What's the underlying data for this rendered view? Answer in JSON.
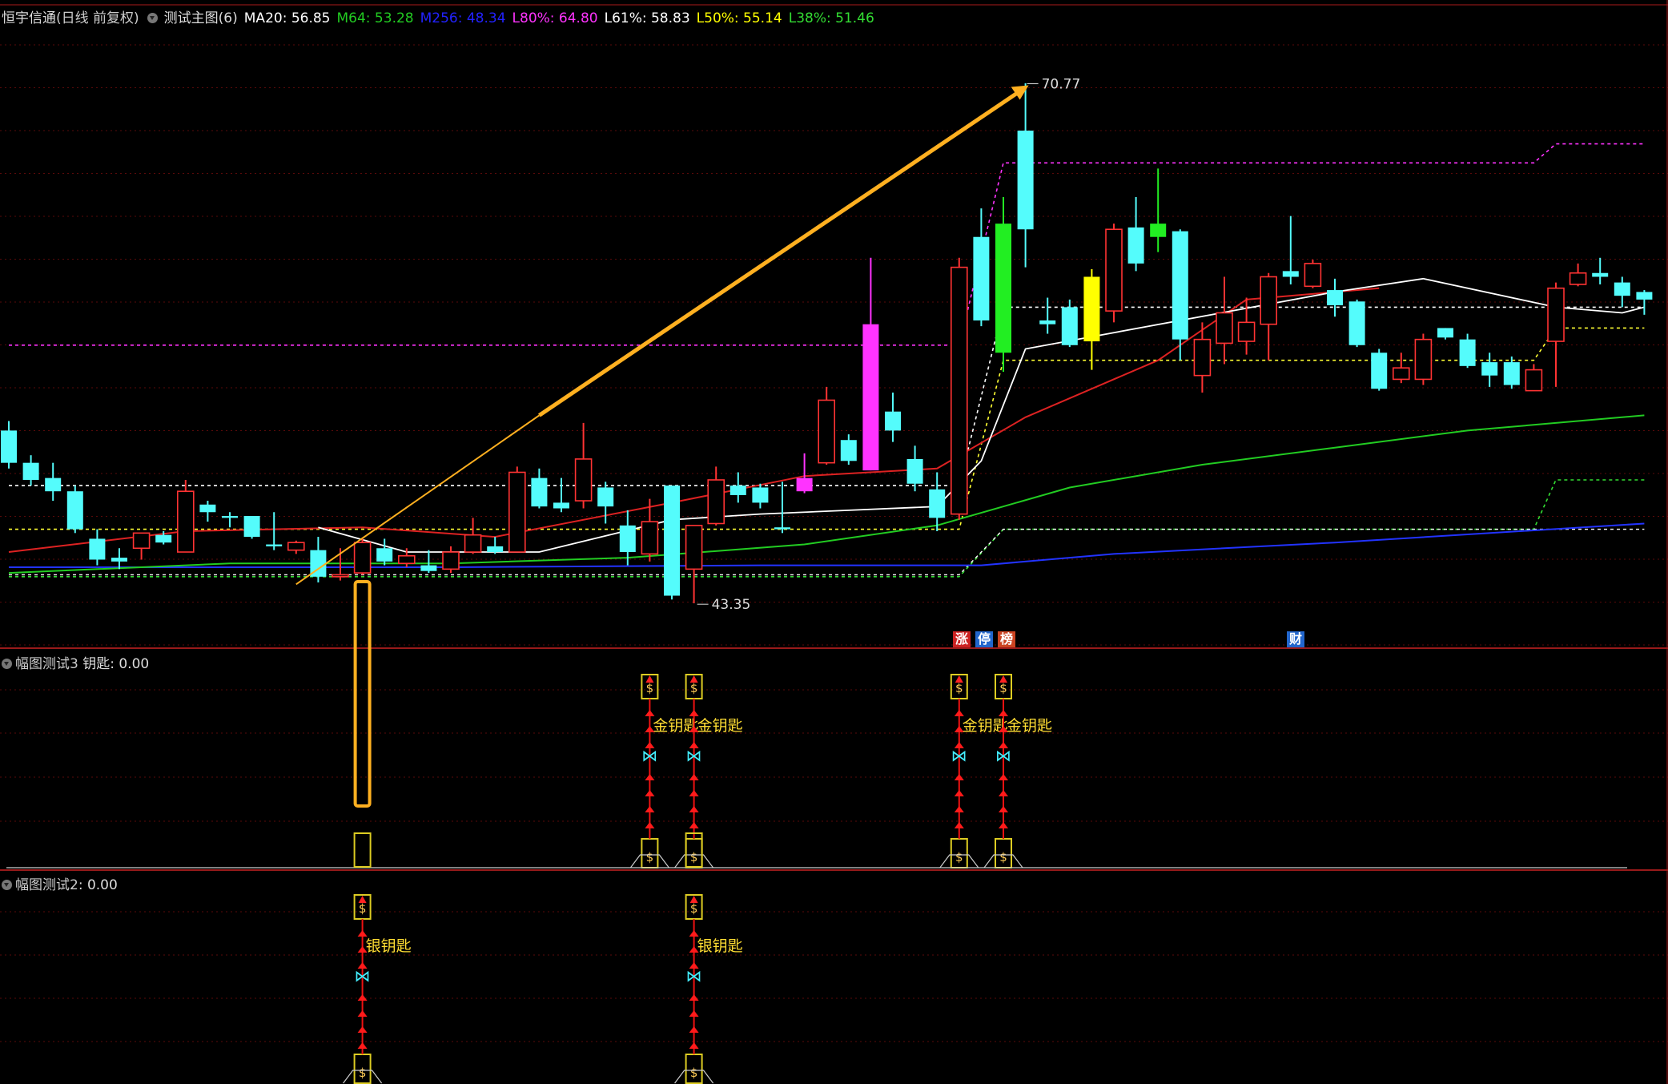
{
  "header": {
    "app_title": "恒宇信通",
    "mode": "(日线 前复权)",
    "main_chart_name": "测试主图(6)",
    "indicators": [
      {
        "label": "MA20: 56.85",
        "color": "#ffffff"
      },
      {
        "label": "M64: 53.28",
        "color": "#22cc22"
      },
      {
        "label": "M256: 48.34",
        "color": "#2222ff"
      },
      {
        "label": "L80%: 64.80",
        "color": "#ff33ff"
      },
      {
        "label": "L61%: 58.83",
        "color": "#ffffff"
      },
      {
        "label": "L50%: 55.14",
        "color": "#ffff00"
      },
      {
        "label": "L38%: 51.46",
        "color": "#33dd33"
      }
    ]
  },
  "pane2": {
    "title": "幅图测试3",
    "value_label": "钥匙: 0.00"
  },
  "pane3": {
    "title": "幅图测试2",
    "value_label": ": 0.00"
  },
  "events": [
    {
      "text": "涨",
      "color": "#cc2222"
    },
    {
      "text": "停",
      "color": "#2266cc"
    },
    {
      "text": "榜",
      "color": "#cc4422"
    },
    {
      "text": "财",
      "color": "#2266cc"
    }
  ],
  "chart_data": {
    "type": "candlestick",
    "annotations": {
      "high": "70.77",
      "low": "43.35",
      "gold_key": "金钥匙",
      "silver_key": "银钥匙"
    },
    "ylim": [
      41.5,
      74
    ],
    "colors": {
      "up": "#ff3333",
      "down": "#54fcfc",
      "ma_short": "#dd2222",
      "ma_mid": "#22cc22",
      "ma_long": "#2233ff",
      "arrow": "#ffb020"
    },
    "candles": [
      [
        52.5,
        50.8,
        53.0,
        50.5,
        "d"
      ],
      [
        50.8,
        49.9,
        51.2,
        49.6,
        "d"
      ],
      [
        50.0,
        49.3,
        50.8,
        48.8,
        "d"
      ],
      [
        49.3,
        47.3,
        49.6,
        47.1,
        "d"
      ],
      [
        46.8,
        45.7,
        47.3,
        45.4,
        "d"
      ],
      [
        45.8,
        45.6,
        46.3,
        45.2,
        "d"
      ],
      [
        46.3,
        47.1,
        47.1,
        45.7,
        "u"
      ],
      [
        47.0,
        46.6,
        47.2,
        46.5,
        "d"
      ],
      [
        46.1,
        49.3,
        49.9,
        46.1,
        "u"
      ],
      [
        48.6,
        48.2,
        48.8,
        47.7,
        "d"
      ],
      [
        48.0,
        47.9,
        48.2,
        47.4,
        "d"
      ],
      [
        48.0,
        46.9,
        48.0,
        46.8,
        "d"
      ],
      [
        46.5,
        46.4,
        48.2,
        46.2,
        "d"
      ],
      [
        46.2,
        46.6,
        46.7,
        46.0,
        "u"
      ],
      [
        46.2,
        44.8,
        46.9,
        44.5,
        "d"
      ],
      [
        44.8,
        44.9,
        46.3,
        44.6,
        "u"
      ],
      [
        45.0,
        46.6,
        46.8,
        44.9,
        "u"
      ],
      [
        46.3,
        45.6,
        46.8,
        45.4,
        "d"
      ],
      [
        45.5,
        45.9,
        46.3,
        45.3,
        "u"
      ],
      [
        45.4,
        45.1,
        46.2,
        45.0,
        "d"
      ],
      [
        45.2,
        46.1,
        46.4,
        45.0,
        "u"
      ],
      [
        46.1,
        47.0,
        47.9,
        46.0,
        "u"
      ],
      [
        46.4,
        46.1,
        46.9,
        46.0,
        "d"
      ],
      [
        46.1,
        50.3,
        50.6,
        46.1,
        "u"
      ],
      [
        50.0,
        48.5,
        50.5,
        48.4,
        "d"
      ],
      [
        48.7,
        48.4,
        50.0,
        48.2,
        "d"
      ],
      [
        48.8,
        51.0,
        52.9,
        48.4,
        "u"
      ],
      [
        49.5,
        48.5,
        49.8,
        47.6,
        "d"
      ],
      [
        47.5,
        46.1,
        48.3,
        45.4,
        "d"
      ],
      [
        46.0,
        47.7,
        48.9,
        45.6,
        "u"
      ],
      [
        49.6,
        43.8,
        49.6,
        43.6,
        "d"
      ],
      [
        45.2,
        47.5,
        47.5,
        43.4,
        "u"
      ],
      [
        47.6,
        49.9,
        50.6,
        47.5,
        "u"
      ],
      [
        49.6,
        49.1,
        50.3,
        48.7,
        "d"
      ],
      [
        49.5,
        48.7,
        49.7,
        48.4,
        "d"
      ],
      [
        47.4,
        47.3,
        49.8,
        47.1,
        "d"
      ],
      [
        49.3,
        50.0,
        51.3,
        49.2,
        "m"
      ],
      [
        50.8,
        54.1,
        54.8,
        50.7,
        "u"
      ],
      [
        52.0,
        50.9,
        52.3,
        50.7,
        "d"
      ],
      [
        50.4,
        58.1,
        61.6,
        50.4,
        "m"
      ],
      [
        53.5,
        52.5,
        54.5,
        51.9,
        "d"
      ],
      [
        51.0,
        49.7,
        51.7,
        49.3,
        "d"
      ],
      [
        49.4,
        47.9,
        50.3,
        47.2,
        "d"
      ],
      [
        48.1,
        61.1,
        61.6,
        47.8,
        "u"
      ],
      [
        58.3,
        62.7,
        64.2,
        58.0,
        "d"
      ],
      [
        56.6,
        63.4,
        64.8,
        55.6,
        "g"
      ],
      [
        68.3,
        63.1,
        70.8,
        61.1,
        "d"
      ],
      [
        58.3,
        58.1,
        59.5,
        57.6,
        "d"
      ],
      [
        59.0,
        57.0,
        59.4,
        56.9,
        "d"
      ],
      [
        57.2,
        60.6,
        61.0,
        55.7,
        "y"
      ],
      [
        58.8,
        63.1,
        63.4,
        58.2,
        "u"
      ],
      [
        63.2,
        61.3,
        64.8,
        60.9,
        "d"
      ],
      [
        63.4,
        62.7,
        66.3,
        61.9,
        "g"
      ],
      [
        63.0,
        57.3,
        63.1,
        56.2,
        "d"
      ],
      [
        55.4,
        57.3,
        58.2,
        54.5,
        "u"
      ],
      [
        57.1,
        58.7,
        60.6,
        56.0,
        "u"
      ],
      [
        57.2,
        58.2,
        59.5,
        56.5,
        "u"
      ],
      [
        58.1,
        60.6,
        60.8,
        56.2,
        "u"
      ],
      [
        60.9,
        60.6,
        63.8,
        60.2,
        "d"
      ],
      [
        60.1,
        61.3,
        61.5,
        60.0,
        "u"
      ],
      [
        59.9,
        59.1,
        60.5,
        58.5,
        "d"
      ],
      [
        59.3,
        57.0,
        59.4,
        56.9,
        "d"
      ],
      [
        56.6,
        54.7,
        56.8,
        54.6,
        "d"
      ],
      [
        55.2,
        55.8,
        56.6,
        55.0,
        "u"
      ],
      [
        55.2,
        57.3,
        57.6,
        54.9,
        "u"
      ],
      [
        57.9,
        57.4,
        57.9,
        57.3,
        "d"
      ],
      [
        57.3,
        55.9,
        57.6,
        55.8,
        "d"
      ],
      [
        55.4,
        56.1,
        56.6,
        54.8,
        "d"
      ],
      [
        56.1,
        54.9,
        56.4,
        54.7,
        "d"
      ],
      [
        54.6,
        55.7,
        56.0,
        54.6,
        "u"
      ],
      [
        57.2,
        60.0,
        60.3,
        54.8,
        "u"
      ],
      [
        60.2,
        60.8,
        61.3,
        60.1,
        "u"
      ],
      [
        60.8,
        60.6,
        61.6,
        60.2,
        "d"
      ],
      [
        60.3,
        59.6,
        60.6,
        59.0,
        "d"
      ],
      [
        59.8,
        59.4,
        59.9,
        58.6,
        "d"
      ]
    ],
    "ma_short_pts": [
      [
        0,
        46.1
      ],
      [
        8,
        47.2
      ],
      [
        16,
        47.4
      ],
      [
        22,
        46.9
      ],
      [
        30,
        48.7
      ],
      [
        36,
        50.1
      ],
      [
        42,
        50.5
      ],
      [
        46,
        53.2
      ],
      [
        52,
        56.2
      ],
      [
        56,
        59.4
      ],
      [
        62,
        60.0
      ]
    ],
    "ma_mid_pts": [
      [
        0,
        45.0
      ],
      [
        10,
        45.5
      ],
      [
        20,
        45.5
      ],
      [
        28,
        45.8
      ],
      [
        36,
        46.5
      ],
      [
        42,
        47.5
      ],
      [
        48,
        49.5
      ],
      [
        54,
        50.7
      ],
      [
        60,
        51.6
      ],
      [
        66,
        52.5
      ],
      [
        74,
        53.3
      ]
    ],
    "ma_long_pts": [
      [
        0,
        45.3
      ],
      [
        20,
        45.3
      ],
      [
        34,
        45.4
      ],
      [
        44,
        45.4
      ],
      [
        50,
        46.0
      ],
      [
        60,
        46.6
      ],
      [
        74,
        47.6
      ]
    ],
    "white_line_pts": [
      [
        14,
        47.4
      ],
      [
        18,
        46.1
      ],
      [
        24,
        46.1
      ],
      [
        30,
        47.8
      ],
      [
        34,
        48.1
      ],
      [
        42,
        48.5
      ],
      [
        44,
        50.9
      ],
      [
        46,
        56.8
      ],
      [
        60,
        59.8
      ],
      [
        64,
        60.5
      ],
      [
        70,
        59.0
      ],
      [
        73,
        58.7
      ],
      [
        74,
        59.0
      ]
    ],
    "zone_lines": {
      "low_dashed": [
        [
          0,
          44.9
        ],
        [
          43,
          44.9
        ],
        [
          45,
          47.3
        ],
        [
          74,
          47.3
        ]
      ],
      "mid_dashed": [
        [
          0,
          47.3
        ],
        [
          43,
          47.3
        ],
        [
          45,
          56.2
        ],
        [
          69,
          56.2
        ],
        [
          70,
          57.9
        ],
        [
          74,
          57.9
        ]
      ],
      "white_dashed": [
        [
          0,
          49.6
        ],
        [
          43,
          49.6
        ],
        [
          45,
          59.0
        ],
        [
          74,
          59.0
        ]
      ],
      "magenta_dashed": [
        [
          0,
          57.0
        ],
        [
          43,
          57.0
        ],
        [
          45,
          66.6
        ],
        [
          69,
          66.6
        ],
        [
          70,
          67.6
        ],
        [
          74,
          67.6
        ]
      ],
      "green_dashed": [
        [
          0,
          44.8
        ],
        [
          43,
          44.8
        ],
        [
          45,
          47.3
        ],
        [
          69,
          47.3
        ],
        [
          70,
          49.9
        ],
        [
          74,
          49.9
        ]
      ]
    },
    "gold_key_idx": [
      29,
      31,
      43,
      45
    ],
    "silver_key_idx": [
      16,
      31
    ],
    "box_idx": 16
  }
}
